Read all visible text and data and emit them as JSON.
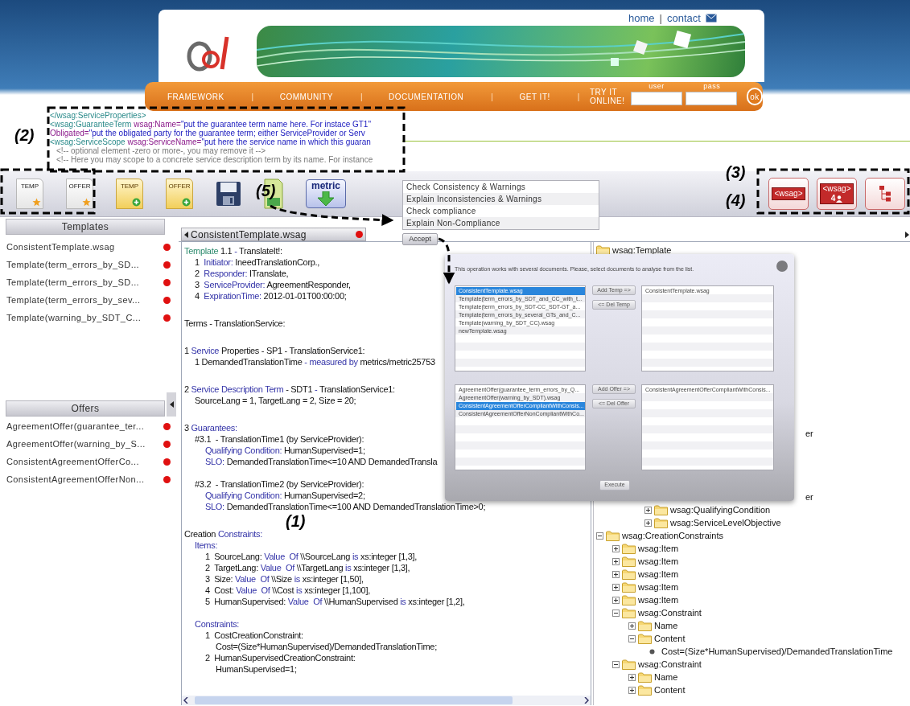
{
  "header": {
    "links": [
      {
        "kind": "link",
        "text": "home"
      },
      {
        "kind": "separator",
        "text": "|"
      },
      {
        "kind": "link",
        "text": "contact"
      }
    ],
    "nav": [
      {
        "kind": "link",
        "text": "FRAMEWORK"
      },
      {
        "kind": "separator",
        "text": "|"
      },
      {
        "kind": "link",
        "text": "COMMUNITY"
      },
      {
        "kind": "separator",
        "text": "|"
      },
      {
        "kind": "link",
        "text": "DOCUMENTATION"
      },
      {
        "kind": "separator",
        "text": "|"
      },
      {
        "kind": "link",
        "text": "GET IT!"
      },
      {
        "kind": "separator",
        "text": "|"
      }
    ],
    "try_online": "TRY IT ONLINE!",
    "fields": [
      {
        "label": "user"
      },
      {
        "label": "pass"
      }
    ],
    "ok": "ok"
  },
  "code_snippet": [
    {
      "s": [
        {
          "kind": "tag",
          "text": "</wsag:ServiceProperties>"
        }
      ]
    },
    {
      "s": [
        {
          "kind": "tag",
          "text": "<wsag:GuaranteeTerm"
        },
        {
          "kind": "attr",
          "text": " wsag:Name="
        },
        {
          "kind": "value",
          "text": "\"put the guarantee term name here. For instace GT1\""
        }
      ]
    },
    {
      "s": [
        {
          "kind": "attr",
          "text": "Obligated="
        },
        {
          "kind": "value",
          "text": "\"put the obligated party for the guarantee term; either ServiceProvider or Serv"
        }
      ]
    },
    {
      "s": [
        {
          "kind": "tag",
          "text": "<wsag:ServiceScope"
        },
        {
          "kind": "attr",
          "text": " wsag:ServiceName="
        },
        {
          "kind": "value",
          "text": "\"put here the service name in which this guaran"
        }
      ],
      "children": [
        {
          "s": [
            {
              "kind": "comment",
              "text": "<!-- optional element -zero or more-, you may remove it -->"
            }
          ]
        },
        {
          "s": [
            {
              "kind": "comment",
              "text": "<!-- Here you may scope to a concrete service description term by its name. For instance"
            }
          ]
        }
      ]
    }
  ],
  "toolbar": {
    "left": [
      {
        "kind": "temp-star",
        "label": "TEMP"
      },
      {
        "kind": "offer-star",
        "label": "OFFER"
      },
      {
        "kind": "temp-add",
        "label": "TEMP"
      },
      {
        "kind": "offer-add",
        "label": "OFFER"
      },
      {
        "kind": "save"
      },
      {
        "kind": "green-doc"
      },
      {
        "kind": "metric",
        "label": "metric"
      }
    ],
    "right": [
      {
        "kind": "wsag",
        "label": "<wsag>"
      },
      {
        "kind": "wsag-person",
        "label": "<wsag>",
        "sub": "4"
      },
      {
        "kind": "tree"
      }
    ]
  },
  "menu": {
    "items": [
      "Check Consistency & Warnings",
      "Explain Inconsistencies & Warnings",
      "Check compliance",
      "Explain Non-Compliance"
    ],
    "accept": "Accept"
  },
  "templates": {
    "title": "Templates",
    "items": [
      "ConsistentTemplate.wsag",
      "Template(term_errors_by_SD...",
      "Template(term_errors_by_SD...",
      "Template(term_errors_by_sev...",
      "Template(warning_by_SDT_C..."
    ]
  },
  "offers": {
    "title": "Offers",
    "items": [
      "AgreementOffer(guarantee_ter...",
      "AgreementOffer(warning_by_S...",
      "ConsistentAgreementOfferCo...",
      "ConsistentAgreementOfferNon..."
    ]
  },
  "editor": {
    "tab": "ConsistentTemplate.wsag",
    "lines": [
      {
        "s": [
          {
            "kind": "name",
            "text": "Template"
          },
          {
            "kind": "txt",
            "text": " 1.1 "
          },
          {
            "kind": "kw",
            "text": "-"
          },
          {
            "kind": "txt",
            "text": " TranslateIt!:"
          }
        ],
        "children": [
          {
            "s": [
              {
                "kind": "txt",
                "text": "1  "
              },
              {
                "kind": "kw",
                "text": "Initiator:"
              },
              {
                "kind": "txt",
                "text": " IneedTranslationCorp.,"
              }
            ]
          },
          {
            "s": [
              {
                "kind": "txt",
                "text": "2  "
              },
              {
                "kind": "kw",
                "text": "Responder:"
              },
              {
                "kind": "txt",
                "text": " ITranslate,"
              }
            ]
          },
          {
            "s": [
              {
                "kind": "txt",
                "text": "3  "
              },
              {
                "kind": "kw",
                "text": "ServiceProvider:"
              },
              {
                "kind": "txt",
                "text": " AgreementResponder,"
              }
            ]
          },
          {
            "s": [
              {
                "kind": "txt",
                "text": "4  "
              },
              {
                "kind": "kw",
                "text": "ExpirationTime:"
              },
              {
                "kind": "txt",
                "text": " 2012-01-01T00:00:00;"
              }
            ]
          }
        ]
      },
      {
        "s": [
          {
            "kind": "txt",
            "text": "Terms - TranslationService:"
          }
        ]
      },
      {
        "s": [
          {
            "kind": "txt",
            "text": "1 "
          },
          {
            "kind": "kw",
            "text": "Service"
          },
          {
            "kind": "txt",
            "text": " Properties - SP1 - TranslationService1:"
          }
        ],
        "children": [
          {
            "s": [
              {
                "kind": "txt",
                "text": "1 DemandedTranslationTime "
              },
              {
                "kind": "kw",
                "text": "- measured by"
              },
              {
                "kind": "txt",
                "text": " metrics/metric25753"
              }
            ]
          }
        ]
      },
      {
        "s": [
          {
            "kind": "txt",
            "text": "2 "
          },
          {
            "kind": "kw",
            "text": "Service Description Term"
          },
          {
            "kind": "txt",
            "text": " - SDT1 "
          },
          {
            "kind": "kw",
            "text": "-"
          },
          {
            "kind": "txt",
            "text": " TranslationService1:"
          }
        ],
        "children": [
          {
            "s": [
              {
                "kind": "txt",
                "text": "SourceLang = 1, TargetLang = 2, Size = 20;"
              }
            ]
          }
        ]
      },
      {
        "s": [
          {
            "kind": "txt",
            "text": "3 "
          },
          {
            "kind": "kw",
            "text": "Guarantees:"
          }
        ],
        "children": [
          {
            "s": [
              {
                "kind": "txt",
                "text": "#3.1  - TranslationTime1 (by ServiceProvider):"
              }
            ],
            "children": [
              {
                "s": [
                  {
                    "kind": "kw",
                    "text": "Qualifying Condition:"
                  },
                  {
                    "kind": "txt",
                    "text": " HumanSupervised=1;"
                  }
                ]
              },
              {
                "s": [
                  {
                    "kind": "kw",
                    "text": "SLO:"
                  },
                  {
                    "kind": "txt",
                    "text": " DemandedTranslationTime<=10 AND DemandedTransla"
                  }
                ]
              }
            ]
          },
          {
            "s": [
              {
                "kind": "txt",
                "text": "#3.2  - TranslationTime2 (by ServiceProvider):"
              }
            ],
            "children": [
              {
                "s": [
                  {
                    "kind": "kw",
                    "text": "Qualifying Condition:"
                  },
                  {
                    "kind": "txt",
                    "text": " HumanSupervised=2;"
                  }
                ]
              },
              {
                "s": [
                  {
                    "kind": "kw",
                    "text": "SLO:"
                  },
                  {
                    "kind": "txt",
                    "text": " DemandedTranslationTime<=100 AND DemandedTranslationTime>0;"
                  }
                ]
              }
            ]
          }
        ]
      },
      {
        "s": [
          {
            "kind": "txt",
            "text": "Creation "
          },
          {
            "kind": "kw",
            "text": "Constraints:"
          }
        ],
        "children": [
          {
            "s": [
              {
                "kind": "kw",
                "text": "Items:"
              }
            ],
            "children": [
              {
                "s": [
                  {
                    "kind": "txt",
                    "text": "1  SourceLang: "
                  },
                  {
                    "kind": "kw",
                    "text": "Value  Of"
                  },
                  {
                    "kind": "txt",
                    "text": " \\\\SourceLang "
                  },
                  {
                    "kind": "kw",
                    "text": "is"
                  },
                  {
                    "kind": "txt",
                    "text": " xs:integer [1,3],"
                  }
                ]
              },
              {
                "s": [
                  {
                    "kind": "txt",
                    "text": "2  TargetLang: "
                  },
                  {
                    "kind": "kw",
                    "text": "Value  Of"
                  },
                  {
                    "kind": "txt",
                    "text": " \\\\TargetLang "
                  },
                  {
                    "kind": "kw",
                    "text": "is"
                  },
                  {
                    "kind": "txt",
                    "text": " xs:integer [1,3],"
                  }
                ]
              },
              {
                "s": [
                  {
                    "kind": "txt",
                    "text": "3  Size: "
                  },
                  {
                    "kind": "kw",
                    "text": "Value  Of"
                  },
                  {
                    "kind": "txt",
                    "text": " \\\\Size "
                  },
                  {
                    "kind": "kw",
                    "text": "is"
                  },
                  {
                    "kind": "txt",
                    "text": " xs:integer [1,50],"
                  }
                ]
              },
              {
                "s": [
                  {
                    "kind": "txt",
                    "text": "4  Cost: "
                  },
                  {
                    "kind": "kw",
                    "text": "Value  Of"
                  },
                  {
                    "kind": "txt",
                    "text": " \\\\Cost "
                  },
                  {
                    "kind": "kw",
                    "text": "is"
                  },
                  {
                    "kind": "txt",
                    "text": " xs:integer [1,100],"
                  }
                ]
              },
              {
                "s": [
                  {
                    "kind": "txt",
                    "text": "5  HumanSupervised: "
                  },
                  {
                    "kind": "kw",
                    "text": "Value  Of"
                  },
                  {
                    "kind": "txt",
                    "text": " \\\\HumanSupervised "
                  },
                  {
                    "kind": "kw",
                    "text": "is"
                  },
                  {
                    "kind": "txt",
                    "text": " xs:integer [1,2],"
                  }
                ]
              }
            ]
          },
          {
            "s": [
              {
                "kind": "kw",
                "text": "Constraints:"
              }
            ],
            "children": [
              {
                "s": [
                  {
                    "kind": "txt",
                    "text": "1  CostCreationConstraint:"
                  }
                ],
                "children": [
                  {
                    "s": [
                      {
                        "kind": "txt",
                        "text": "Cost=(Size*HumanSupervised)/DemandedTranslationTime;"
                      }
                    ]
                  }
                ]
              },
              {
                "s": [
                  {
                    "kind": "txt",
                    "text": "2  HumanSupervisedCreationConstraint:"
                  }
                ],
                "children": [
                  {
                    "s": [
                      {
                        "kind": "txt",
                        "text": "HumanSupervised=1;"
                      }
                    ]
                  }
                ]
              }
            ]
          }
        ]
      }
    ]
  },
  "right_panel": {
    "tree": [
      {
        "label": "wsag:Template",
        "children": [
          {
            "children": [
              {
                "children": [
                  {
                    "children": [
                      {
                        "kind": "partial",
                        "label": "er"
                      },
                      {
                        "kind": "partial",
                        "label": "er"
                      },
                      {
                        "label": "wsag:QualifyingCondition",
                        "expanded": false
                      },
                      {
                        "label": "wsag:ServiceLevelObjective",
                        "expanded": false
                      }
                    ]
                  }
                ]
              }
            ]
          },
          {
            "label": "wsag:CreationConstraints",
            "expanded": true,
            "children": [
              {
                "label": "wsag:Item",
                "expanded": false
              },
              {
                "label": "wsag:Item",
                "expanded": false
              },
              {
                "label": "wsag:Item",
                "expanded": false
              },
              {
                "label": "wsag:Item",
                "expanded": false
              },
              {
                "label": "wsag:Item",
                "expanded": false
              },
              {
                "label": "wsag:Constraint",
                "expanded": true,
                "children": [
                  {
                    "label": "Name",
                    "expanded": false
                  },
                  {
                    "label": "Content",
                    "expanded": true,
                    "children": [
                      {
                        "kind": "value",
                        "label": "Cost=(Size*HumanSupervised)/DemandedTranslationTime"
                      }
                    ]
                  }
                ]
              },
              {
                "label": "wsag:Constraint",
                "expanded": true,
                "children": [
                  {
                    "label": "Name",
                    "expanded": false
                  },
                  {
                    "label": "Content",
                    "expanded": false
                  }
                ]
              }
            ]
          }
        ]
      }
    ]
  },
  "dialog": {
    "message": "This operation works with several documents. Please, select documents to analyse from the list.",
    "sections": [
      {
        "available": [
          {
            "label": "ConsistentTemplate.wsag",
            "selected": true
          },
          {
            "label": "Template(term_errors_by_SDT_and_CC_with_t...",
            "selected": false
          },
          {
            "label": "Template(term_errors_by_SDT-CC_SDT-GT_a...",
            "selected": false
          },
          {
            "label": "Template(term_errors_by_several_GTs_and_C...",
            "selected": false
          },
          {
            "label": "Template(warning_by_SDT_CC).wsag",
            "selected": false
          },
          {
            "label": "newTemplate.wsag",
            "selected": false
          }
        ],
        "add": "Add Temp =>",
        "remove": "<= Del Temp",
        "chosen": [
          {
            "label": "ConsistentTemplate.wsag",
            "selected": false
          }
        ]
      },
      {
        "available": [
          {
            "label": "AgreementOffer(guarantee_term_errors_by_Q...",
            "selected": false
          },
          {
            "label": "AgreementOffer(warning_by_SDT).wsag",
            "selected": false
          },
          {
            "label": "ConsistentAgreementOfferCompliantWithConsis...",
            "selected": true
          },
          {
            "label": "ConsistentAgreementOfferNonCompliantWithCo...",
            "selected": false
          }
        ],
        "add": "Add Offer =>",
        "remove": "<= Del Offer",
        "chosen": [
          {
            "label": "ConsistentAgreementOfferCompliantWithConsis...",
            "selected": false
          }
        ]
      }
    ],
    "execute": "Execute"
  },
  "annotations": [
    "(2)",
    "(3)",
    "(4)",
    "(5)",
    "(1)"
  ]
}
